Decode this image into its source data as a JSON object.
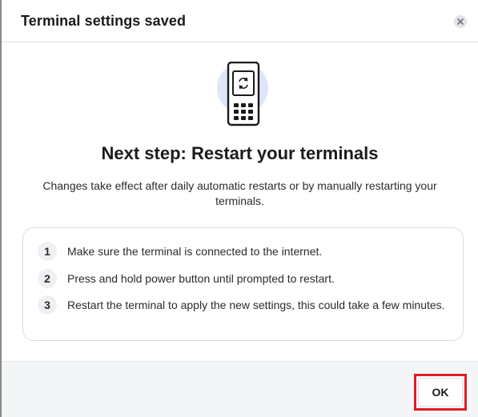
{
  "dialog": {
    "title": "Terminal settings saved",
    "close_icon": "close-icon"
  },
  "content": {
    "illustration_icon": "terminal-restart-icon",
    "heading": "Next step: Restart your terminals",
    "description": "Changes take effect after daily automatic restarts or by manually restarting your terminals.",
    "steps": [
      {
        "number": "1",
        "text": "Make sure the terminal is connected to the internet."
      },
      {
        "number": "2",
        "text": "Press and hold power button until prompted to restart."
      },
      {
        "number": "3",
        "text": "Restart the terminal to apply the new settings, this could take a few minutes."
      }
    ]
  },
  "footer": {
    "ok_label": "OK"
  },
  "colors": {
    "highlight": "#e01b24",
    "illustration_bg": "#dfe6fb",
    "card_border": "#d9dce1"
  }
}
